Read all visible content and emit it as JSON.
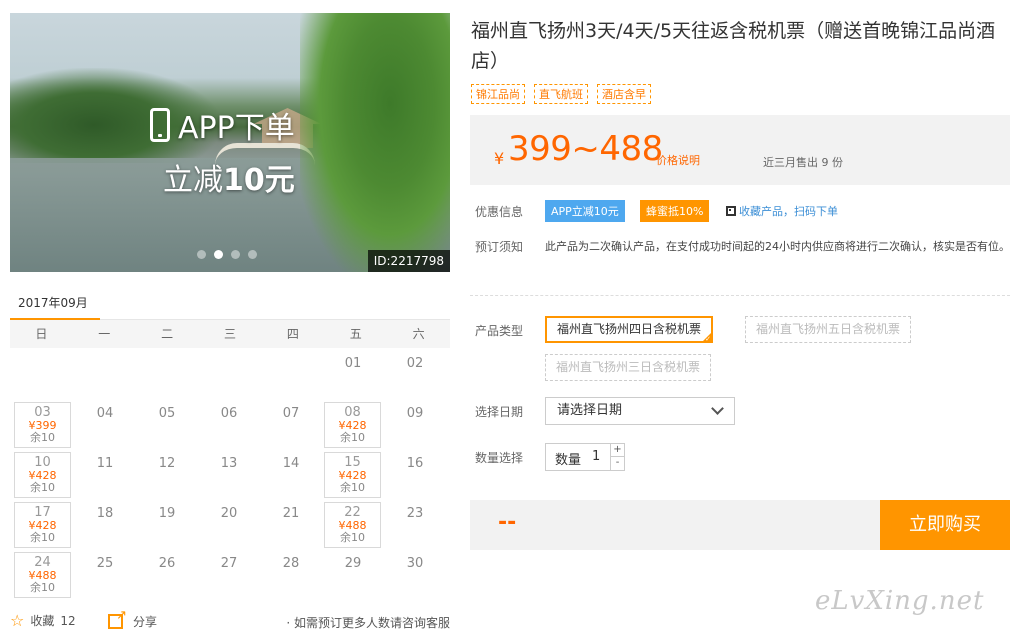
{
  "hero": {
    "promo_line1": "APP下单",
    "promo_line2_prefix": "立减",
    "promo_line2_amount": "10元",
    "id_label": "ID:2217798",
    "carousel_count": 4,
    "carousel_active": 2
  },
  "calendar": {
    "month": "2017年09月",
    "weekdays": [
      "日",
      "一",
      "二",
      "三",
      "四",
      "五",
      "六"
    ],
    "days": [
      {
        "d": "",
        "price": "",
        "remain": ""
      },
      {
        "d": "",
        "price": "",
        "remain": ""
      },
      {
        "d": "",
        "price": "",
        "remain": ""
      },
      {
        "d": "",
        "price": "",
        "remain": ""
      },
      {
        "d": "",
        "price": "",
        "remain": ""
      },
      {
        "d": "01",
        "price": "",
        "remain": ""
      },
      {
        "d": "02",
        "price": "",
        "remain": ""
      },
      {
        "d": "03",
        "price": "¥399",
        "remain": "余10"
      },
      {
        "d": "04",
        "price": "",
        "remain": ""
      },
      {
        "d": "05",
        "price": "",
        "remain": ""
      },
      {
        "d": "06",
        "price": "",
        "remain": ""
      },
      {
        "d": "07",
        "price": "",
        "remain": ""
      },
      {
        "d": "08",
        "price": "¥428",
        "remain": "余10"
      },
      {
        "d": "09",
        "price": "",
        "remain": ""
      },
      {
        "d": "10",
        "price": "¥428",
        "remain": "余10"
      },
      {
        "d": "11",
        "price": "",
        "remain": ""
      },
      {
        "d": "12",
        "price": "",
        "remain": ""
      },
      {
        "d": "13",
        "price": "",
        "remain": ""
      },
      {
        "d": "14",
        "price": "",
        "remain": ""
      },
      {
        "d": "15",
        "price": "¥428",
        "remain": "余10"
      },
      {
        "d": "16",
        "price": "",
        "remain": ""
      },
      {
        "d": "17",
        "price": "¥428",
        "remain": "余10"
      },
      {
        "d": "18",
        "price": "",
        "remain": ""
      },
      {
        "d": "19",
        "price": "",
        "remain": ""
      },
      {
        "d": "20",
        "price": "",
        "remain": ""
      },
      {
        "d": "21",
        "price": "",
        "remain": ""
      },
      {
        "d": "22",
        "price": "¥488",
        "remain": "余10"
      },
      {
        "d": "23",
        "price": "",
        "remain": ""
      },
      {
        "d": "24",
        "price": "¥488",
        "remain": "余10"
      },
      {
        "d": "25",
        "price": "",
        "remain": ""
      },
      {
        "d": "26",
        "price": "",
        "remain": ""
      },
      {
        "d": "27",
        "price": "",
        "remain": ""
      },
      {
        "d": "28",
        "price": "",
        "remain": ""
      },
      {
        "d": "29",
        "price": "",
        "remain": ""
      },
      {
        "d": "30",
        "price": "",
        "remain": ""
      }
    ]
  },
  "actions": {
    "favorite_label": "收藏",
    "favorite_count": "12",
    "share_label": "分享",
    "consult_text": "· 如需预订更多人数请咨询客服"
  },
  "product": {
    "title": "福州直飞扬州3天/4天/5天往返含税机票（赠送首晚锦江品尚酒店）",
    "tags": [
      "锦江品尚",
      "直飞航班",
      "酒店含早"
    ],
    "currency": "¥",
    "price_range": "399~488",
    "price_note": "价格说明",
    "sold_text": "近三月售出 9 份"
  },
  "offers": {
    "label": "优惠信息",
    "app_badge": "APP立减10元",
    "honey_badge": "蜂蜜抵10%",
    "qr_link": "收藏产品，扫码下单"
  },
  "booking_notice": {
    "label": "预订须知",
    "text": "此产品为二次确认产品，在支付成功时间起的24小时内供应商将进行二次确认，核实是否有位。"
  },
  "product_type": {
    "label": "产品类型",
    "options": [
      "福州直飞扬州四日含税机票",
      "福州直飞扬州五日含税机票",
      "福州直飞扬州三日含税机票"
    ],
    "selected_index": 0
  },
  "date_select": {
    "label": "选择日期",
    "placeholder": "请选择日期"
  },
  "quantity": {
    "label": "数量选择",
    "field_label": "数量",
    "value": "1",
    "plus": "+",
    "minus": "-"
  },
  "purchase": {
    "total": "--",
    "buy_label": "立即购买"
  },
  "watermark": "eLvXing.net",
  "colors": {
    "accent": "#ff9500",
    "price": "#ff6600",
    "link": "#3d8fd6",
    "badge_blue": "#4ea8ef"
  }
}
